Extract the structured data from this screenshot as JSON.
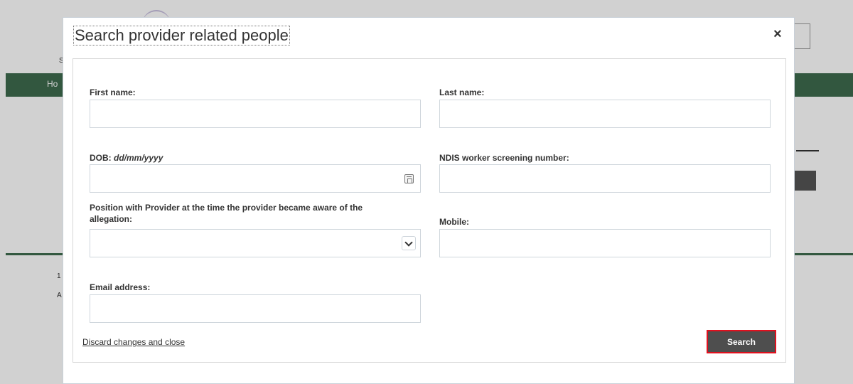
{
  "background": {
    "nav_text": "Ho",
    "small_text_1": "1",
    "small_text_2": "A",
    "side_text": "S"
  },
  "modal": {
    "title": "Search provider related people",
    "close_label": "×"
  },
  "form": {
    "first_name": {
      "label": "First name:",
      "value": ""
    },
    "last_name": {
      "label": "Last name:",
      "value": ""
    },
    "dob": {
      "label": "DOB: ",
      "hint": "dd/mm/yyyy",
      "value": ""
    },
    "ndis": {
      "label": "NDIS worker screening number:",
      "value": ""
    },
    "position": {
      "label_line1": "Position with Provider at the time the provider became aware of the",
      "label_line2": "allegation:",
      "selected": ""
    },
    "mobile": {
      "label": "Mobile:",
      "value": ""
    },
    "email": {
      "label": "Email address:",
      "value": ""
    }
  },
  "actions": {
    "discard_label": "Discard changes and close",
    "search_label": "Search"
  },
  "colors": {
    "nav_green": "#3e6b4d",
    "button_dark": "#4e4e4e",
    "highlight_red": "#e0101e"
  }
}
